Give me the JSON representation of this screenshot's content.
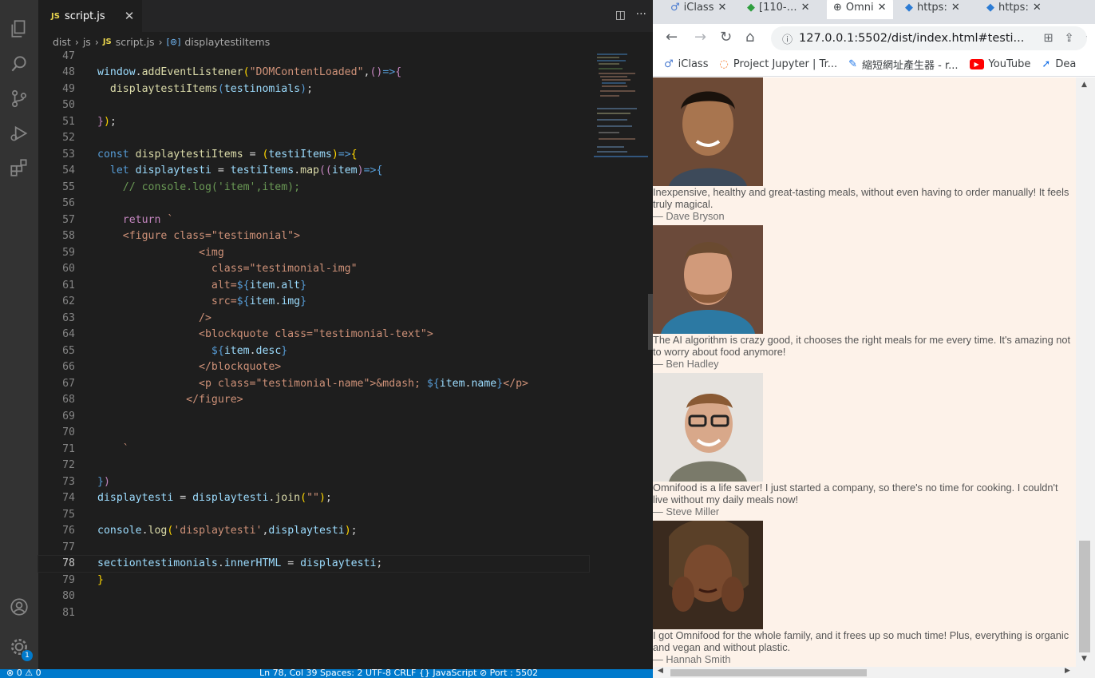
{
  "editor": {
    "tab_label": "script.js",
    "lang_badge": "JS",
    "breadcrumb": {
      "dist": "dist",
      "js": "js",
      "file": "script.js",
      "symbol": "displaytestiItems"
    }
  },
  "status": {
    "left": "⊗ 0 ⚠ 0",
    "right": "Ln 78, Col 39    Spaces: 2    UTF-8    CRLF    {} JavaScript    ⊘ Port : 5502",
    "badge": "1"
  },
  "browser": {
    "tabs": [
      "iClass",
      "[110-…",
      "Omni",
      "https:",
      "https:"
    ],
    "url": "127.0.0.1:5502/dist/index.html#testi...",
    "bookmarks": [
      "iClass",
      "Project Jupyter | Tr...",
      "縮短網址產生器 - r...",
      "YouTube",
      "Dea"
    ]
  },
  "testimonials": [
    {
      "desc": "Inexpensive, healthy and great-tasting meals, without even having to order manually! It feels truly magical.",
      "name": "— Dave Bryson",
      "img_color": "#6d4a36"
    },
    {
      "desc": "The AI algorithm is crazy good, it chooses the right meals for me every time. It's amazing not to worry about food anymore!",
      "name": "— Ben Hadley",
      "img_color": "#2c79a3"
    },
    {
      "desc": "Omnifood is a life saver! I just started a company, so there's no time for cooking. I couldn't live without my daily meals now!",
      "name": "— Steve Miller",
      "img_color": "#d9d6d1"
    },
    {
      "desc": "I got Omnifood for the whole family, and it frees up so much time! Plus, everything is organic and vegan and without plastic.",
      "name": "— Hannah Smith",
      "img_color": "#3a2a1e"
    }
  ],
  "colors": {
    "editor_bg": "#1e1e1e",
    "status_bg": "#007acc",
    "page_bg": "#fdf2e9",
    "accent": "#1a73e8"
  }
}
